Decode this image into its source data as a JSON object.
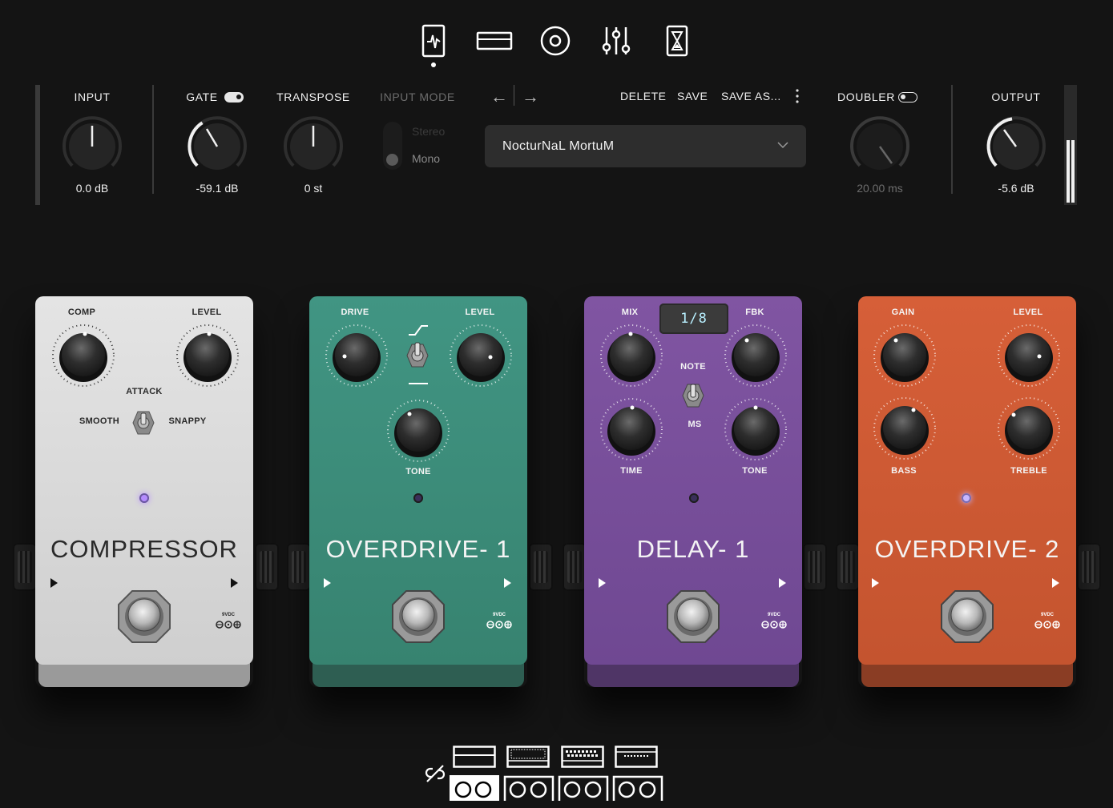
{
  "nav": {
    "items": [
      {
        "name": "tuner-icon",
        "active": true
      },
      {
        "name": "amp-icon",
        "active": false
      },
      {
        "name": "speaker-icon",
        "active": false
      },
      {
        "name": "mixer-icon",
        "active": false
      },
      {
        "name": "hourglass-icon",
        "active": false
      }
    ]
  },
  "controls": {
    "input": {
      "label": "INPUT",
      "value": "0.0 dB"
    },
    "gate": {
      "label": "GATE",
      "value": "-59.1 dB",
      "enabled": true
    },
    "transpose": {
      "label": "TRANSPOSE",
      "value": "0 st"
    },
    "input_mode": {
      "label": "INPUT MODE",
      "options": [
        "Stereo",
        "Mono"
      ],
      "selected": "Mono"
    },
    "doubler": {
      "label": "DOUBLER",
      "value": "20.00 ms",
      "enabled": false
    },
    "output": {
      "label": "OUTPUT",
      "value": "-5.6 dB"
    }
  },
  "preset": {
    "name": "NocturNaL MortuM",
    "actions": {
      "delete": "DELETE",
      "save": "SAVE",
      "save_as": "SAVE AS..."
    }
  },
  "pedals": [
    {
      "id": "compressor",
      "name": "COMPRESSOR",
      "knob_labels": [
        "COMP",
        "LEVEL"
      ],
      "switch_labels": {
        "title": "ATTACK",
        "left": "SMOOTH",
        "right": "SNAPPY"
      },
      "dc": "9VDC",
      "colors": {
        "body": "#d9d9d9",
        "text": "#2a2a2a",
        "led": "#b58cff"
      }
    },
    {
      "id": "overdrive-1",
      "name": "OVERDRIVE- 1",
      "knob_labels": [
        "DRIVE",
        "LEVEL",
        "TONE"
      ],
      "dc": "9VDC",
      "colors": {
        "body": "#3e8e7a",
        "text": "#f4f4f4",
        "led": "#3a2f5a"
      }
    },
    {
      "id": "delay-1",
      "name": "DELAY- 1",
      "display": "1/8",
      "knob_labels": [
        "MIX",
        "FBK",
        "TIME",
        "TONE"
      ],
      "switch_labels": {
        "top": "NOTE",
        "bottom": "MS"
      },
      "dc": "9VDC",
      "colors": {
        "body": "#7a4e9c",
        "text": "#f4f4f4",
        "led": "#3a2f5a"
      }
    },
    {
      "id": "overdrive-2",
      "name": "OVERDRIVE- 2",
      "knob_labels": [
        "GAIN",
        "LEVEL",
        "BASS",
        "TREBLE"
      ],
      "dc": "9VDC",
      "colors": {
        "body": "#cf5a34",
        "text": "#f4f4f4",
        "led": "#c8b8ff"
      }
    }
  ],
  "cabinets": {
    "heads": [
      "amp-head-1",
      "amp-head-2",
      "amp-head-3",
      "amp-head-4"
    ],
    "cabs": [
      "cab-1",
      "cab-2",
      "cab-3",
      "cab-4"
    ],
    "selected_cab": 0
  }
}
